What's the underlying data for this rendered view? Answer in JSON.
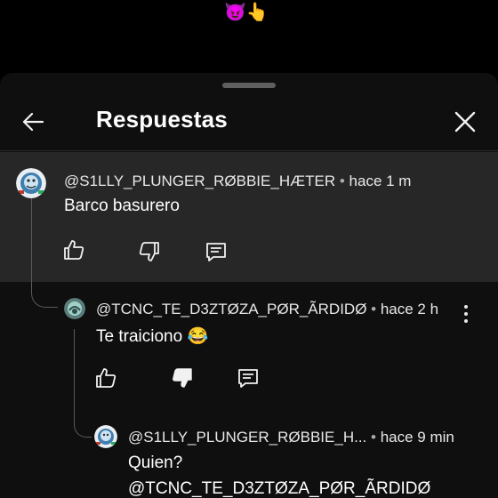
{
  "top_emoji": "😈👆",
  "header": {
    "title": "Respuestas"
  },
  "comments": [
    {
      "author": "@S1LLY_PLUNGER_RØBBIE_HÆTER",
      "time": "hace 1 m",
      "text": "Barco basurero"
    },
    {
      "author": "@TCNC_TE_D3ZTØZA_PØR_ÃRDIDØ",
      "time": "hace 2 h",
      "text": "Te traiciono 😂"
    },
    {
      "author": "@S1LLY_PLUNGER_RØBBIE_H...",
      "time": "hace 9 min",
      "text_line1": "Quien?",
      "text_line2": "@TCNC_TE_D3ZTØZA_PØR_ÃRDIDØ"
    }
  ],
  "separator": "•",
  "colors": {
    "sheet": "#0f0f0f",
    "highlight": "#272727",
    "accent_text": "#f1f1f1"
  }
}
